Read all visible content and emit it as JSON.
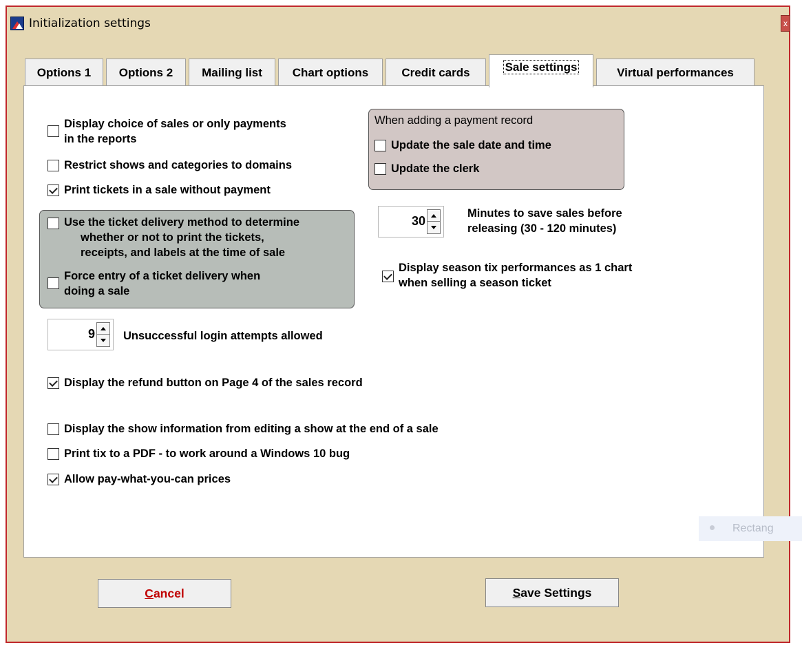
{
  "window": {
    "title": "Initialization settings",
    "close_glyph": "x"
  },
  "icons": {
    "app": "theater-app-icon",
    "close": "close-icon"
  },
  "tabs": [
    {
      "label": "Options 1"
    },
    {
      "label": "Options 2"
    },
    {
      "label": "Mailing list"
    },
    {
      "label": "Chart options"
    },
    {
      "label": "Credit cards"
    },
    {
      "label": "Sale settings",
      "active": true
    },
    {
      "label": "Virtual performances"
    }
  ],
  "options": {
    "display_choice": {
      "line1": "Display choice of sales or only payments",
      "line2": "in the reports",
      "checked": false
    },
    "restrict_shows": {
      "label": "Restrict shows and categories to domains",
      "checked": false
    },
    "print_without_payment": {
      "label": "Print tickets in a sale without payment",
      "checked": true
    },
    "delivery_method": {
      "line1": "Use the ticket delivery method to determine",
      "line2": "whether or not to print the tickets,",
      "line3": "receipts, and labels at the time of sale",
      "checked": false
    },
    "force_delivery": {
      "line1": "Force entry of a ticket delivery when",
      "line2": "doing a sale",
      "checked": false
    },
    "refund_button": {
      "label": "Display the refund button on Page 4 of the sales record",
      "checked": true
    },
    "show_info": {
      "label": "Display the show information from editing a show at the end of a sale",
      "checked": false
    },
    "print_pdf": {
      "label": "Print tix to a PDF - to work around a Windows 10 bug",
      "checked": false
    },
    "pay_what_you_can": {
      "label": "Allow pay-what-you-can prices",
      "checked": true
    },
    "season_tix": {
      "line1": "Display season tix performances as 1 chart",
      "line2": "when selling a season ticket",
      "checked": true
    }
  },
  "payment_group": {
    "heading": "When adding a payment record",
    "update_date": {
      "label": "Update the sale date and time",
      "checked": false
    },
    "update_clerk": {
      "label": "Update the clerk",
      "checked": false
    }
  },
  "login_attempts": {
    "value": "9",
    "label": "Unsuccessful login attempts allowed"
  },
  "save_minutes": {
    "value": "30",
    "line1": "Minutes to save sales before",
    "line2": "releasing (30 - 120 minutes)"
  },
  "buttons": {
    "cancel": {
      "mnemonic": "C",
      "rest": "ancel"
    },
    "save": {
      "mnemonic": "S",
      "rest": "ave Settings"
    }
  },
  "overlay": {
    "text": "Rectang"
  },
  "colors": {
    "window_bg": "#e5d8b4",
    "window_border": "#c0282c",
    "delivery_group_bg": "#b7bdb8",
    "payment_group_bg": "#d2c7c5",
    "cancel_text": "#c00000"
  }
}
